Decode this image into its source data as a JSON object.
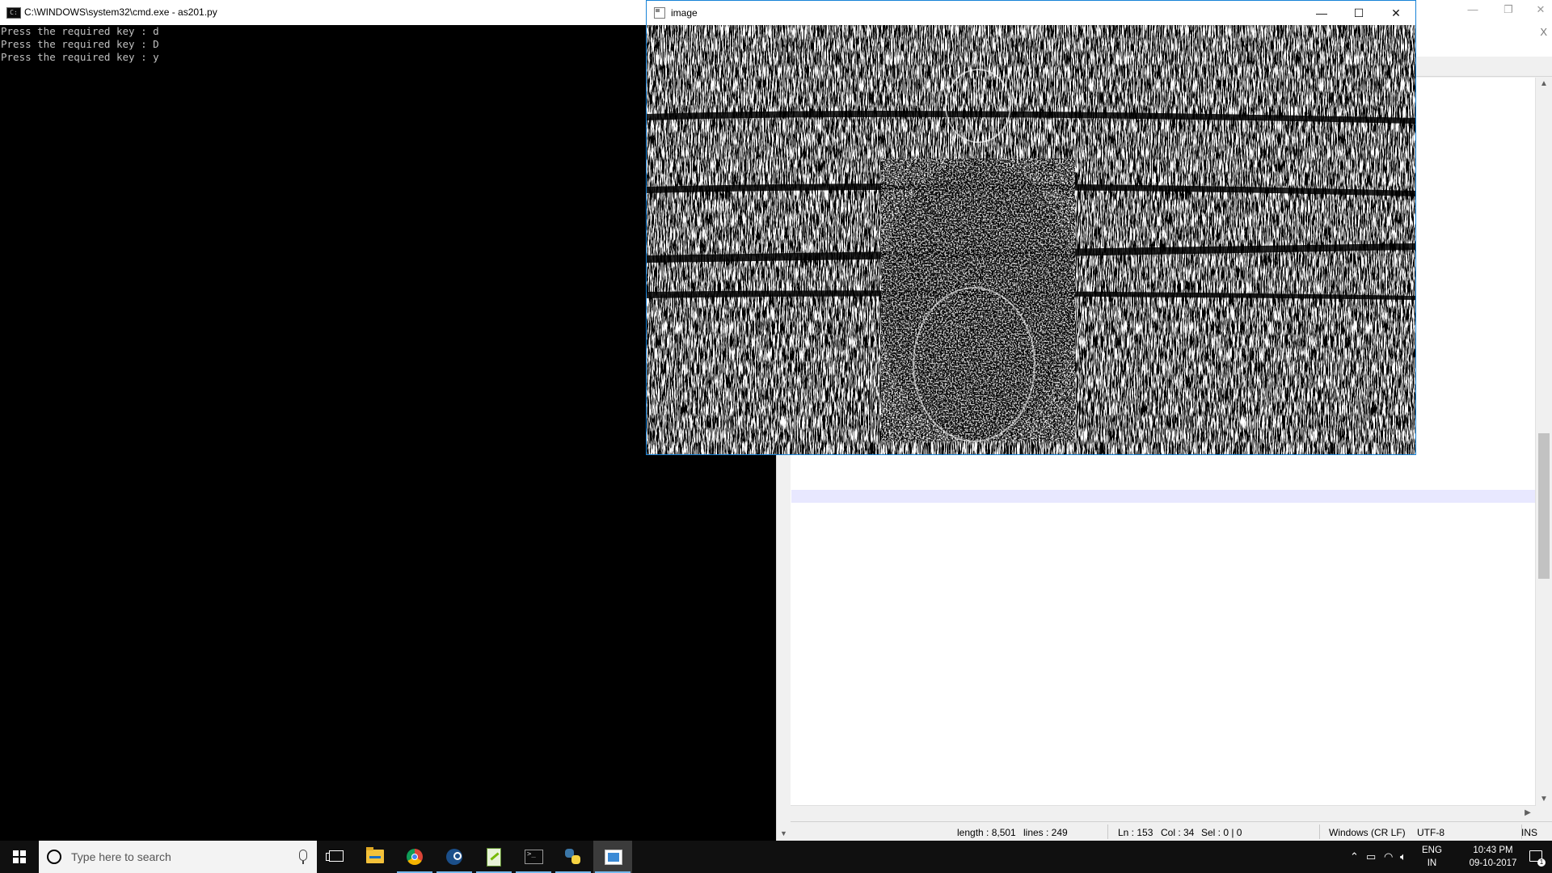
{
  "cmd_window": {
    "title": "C:\\WINDOWS\\system32\\cmd.exe - as201.py",
    "icon": "cmd-icon",
    "lines": [
      "Press the required key : d",
      "Press the required key : D",
      "Press the required key : y"
    ]
  },
  "image_window": {
    "title": "image",
    "icon": "image-window-icon",
    "minimize_glyph": "—",
    "maximize_glyph": "☐",
    "close_glyph": "✕",
    "content": "binary thresholded photo of a person sitting on a beach with waves"
  },
  "notepad_window": {
    "status": {
      "length": "length : 8,501",
      "lines": "lines : 249",
      "ln": "Ln : 153",
      "col": "Col : 34",
      "sel": "Sel : 0 | 0",
      "eol": "Windows (CR LF)",
      "encoding": "UTF-8",
      "mode": "INS"
    },
    "menu_close_glyph": "X"
  },
  "taskbar": {
    "search_placeholder": "Type here to search",
    "apps": [
      "task-view",
      "file-explorer",
      "chrome",
      "steam",
      "notepad-plus-plus",
      "command-prompt",
      "python-idle",
      "image-viewer"
    ],
    "tray": {
      "language": "ENG",
      "region": "IN",
      "time": "10:43 PM",
      "date": "09-10-2017",
      "notification_count": "1"
    }
  },
  "colors": {
    "taskbar_bg": "#101010",
    "active_underline": "#76b9ed",
    "image_window_border": "#1883d7",
    "current_line_highlight": "#e8e8ff"
  }
}
